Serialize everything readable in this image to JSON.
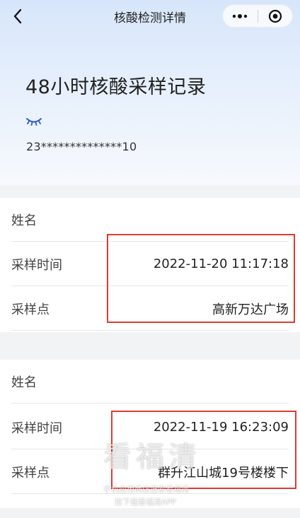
{
  "nav": {
    "title": "核酸检测详情",
    "back_icon": "chevron-left-icon",
    "more_icon": "more-dots-icon",
    "close_icon": "target-circle-icon"
  },
  "header": {
    "title": "48小时核酸采样记录",
    "eye_icon": "eye-closed-icon",
    "id_masked": "23**************10"
  },
  "records": [
    {
      "name_label": "姓名",
      "time_label": "采样时间",
      "time_value": "2022-11-20 11:17:18",
      "site_label": "采样点",
      "site_value": "高新万达广场"
    },
    {
      "name_label": "姓名",
      "time_label": "采样时间",
      "time_value": "2022-11-19 16:23:09",
      "site_label": "采样点",
      "site_value": "群升江山城19号楼楼下"
    }
  ],
  "watermark": {
    "main": "看福清",
    "line1": "手机应用商店搜索看福清",
    "line2": "技下载看福清APP"
  },
  "colors": {
    "highlight": "#e23a2f",
    "header_gradient_top": "#d7e6fb",
    "eye_icon": "#2f5bd3"
  }
}
